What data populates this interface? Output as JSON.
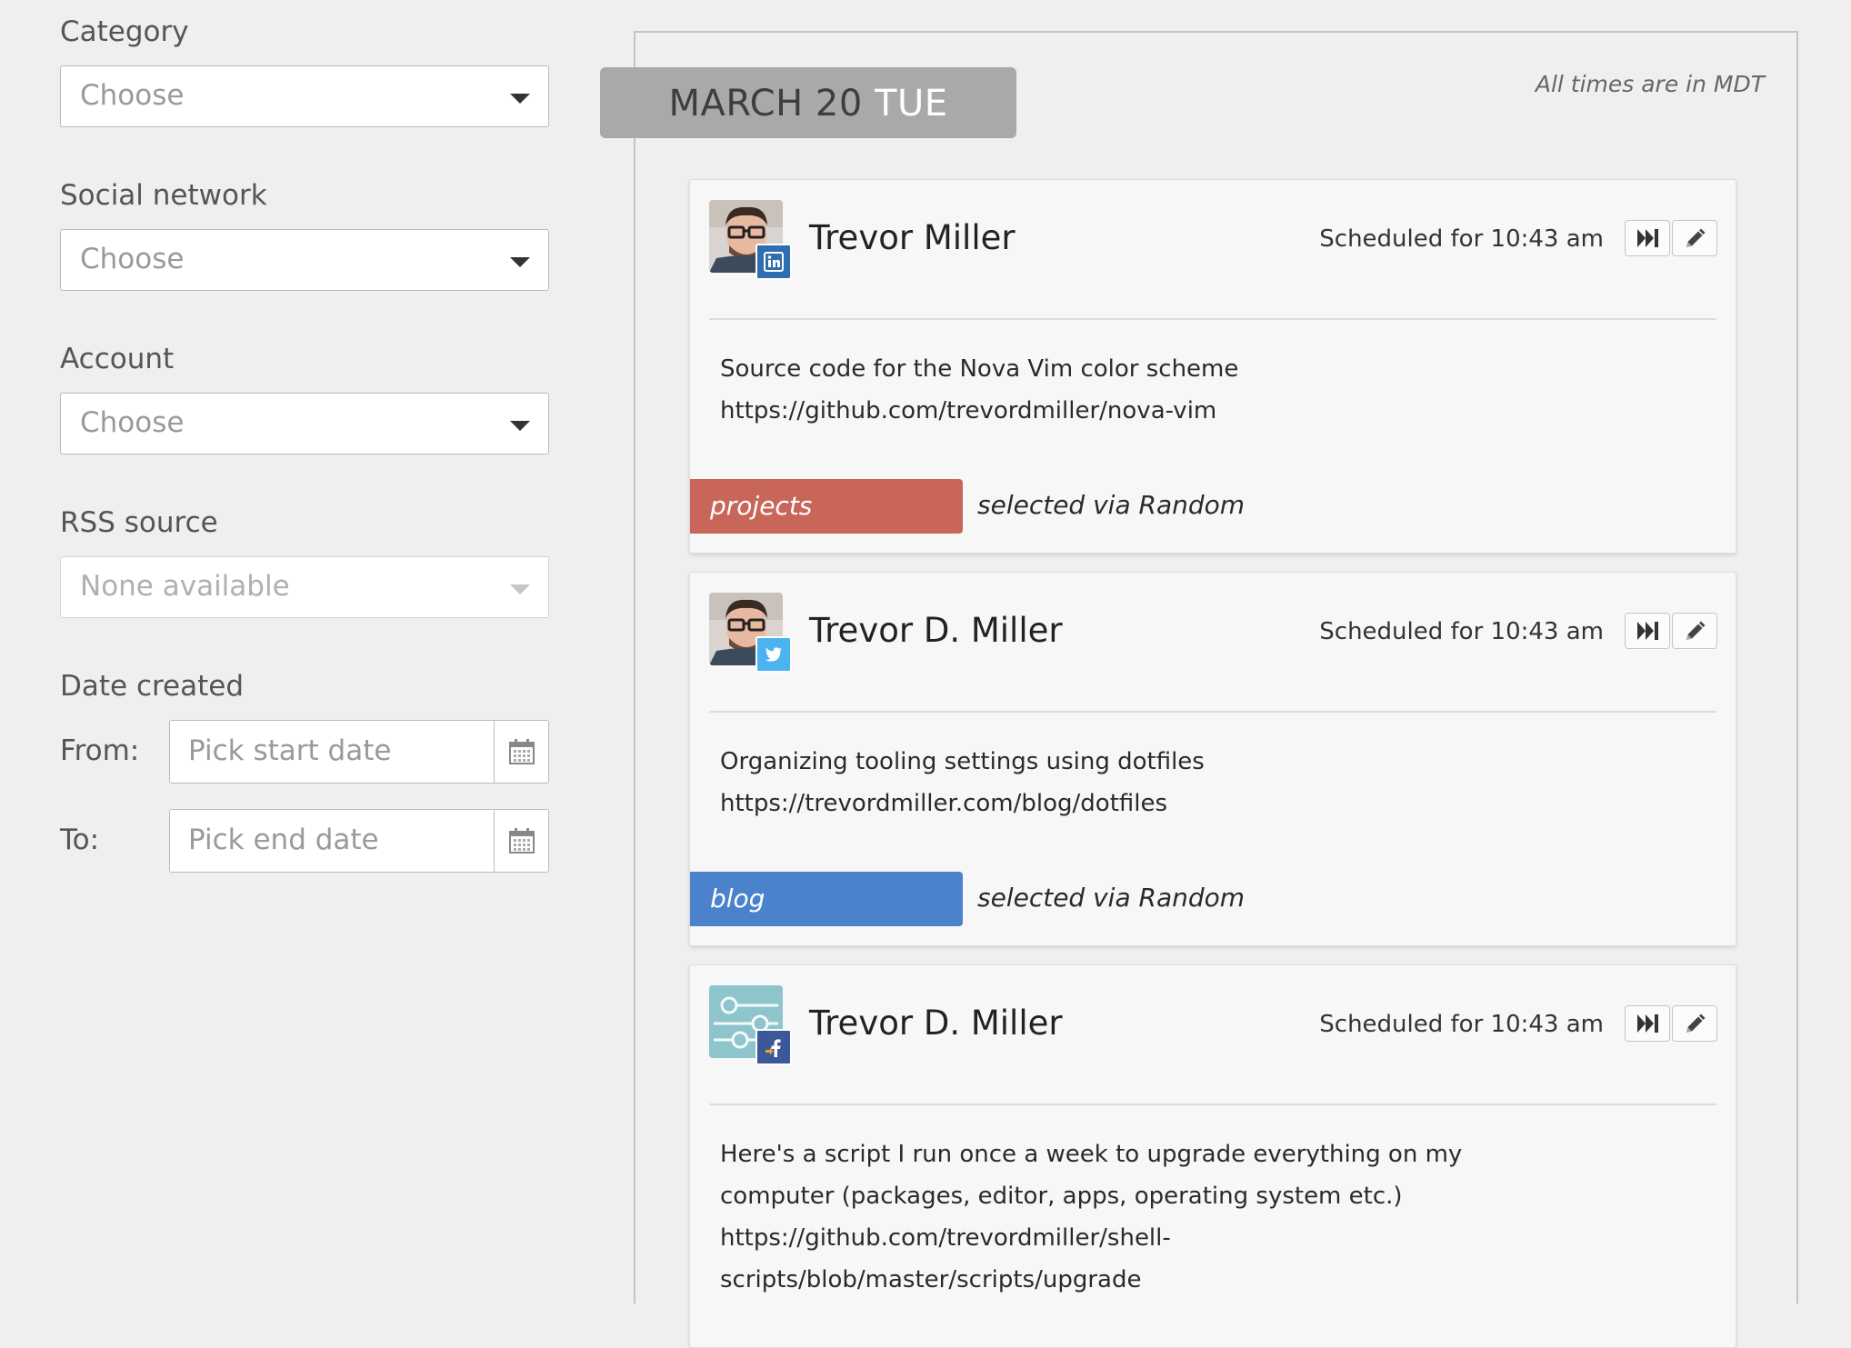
{
  "filters": {
    "category": {
      "label": "Category",
      "placeholder": "Choose"
    },
    "social_network": {
      "label": "Social network",
      "placeholder": "Choose"
    },
    "account": {
      "label": "Account",
      "placeholder": "Choose"
    },
    "rss_source": {
      "label": "RSS source",
      "placeholder": "None available"
    },
    "date_created": {
      "label": "Date created",
      "from_label": "From:",
      "from_placeholder": "Pick start date",
      "to_label": "To:",
      "to_placeholder": "Pick end date"
    }
  },
  "timeline": {
    "date_month_day": "MARCH 20",
    "date_weekday": "TUE",
    "timezone_note": "All times are in MDT",
    "posts": [
      {
        "author": "Trevor Miller",
        "network": "linkedin-icon",
        "scheduled": "Scheduled for 10:43 am",
        "lines": [
          "Source code for the Nova Vim color scheme",
          "https://github.com/trevordmiller/nova-vim"
        ],
        "tag": "projects",
        "tag_color": "#c9665a",
        "via": "selected via Random"
      },
      {
        "author": "Trevor D. Miller",
        "network": "twitter-icon",
        "scheduled": "Scheduled for 10:43 am",
        "lines": [
          "Organizing tooling settings using dotfiles",
          "https://trevordmiller.com/blog/dotfiles"
        ],
        "tag": "blog",
        "tag_color": "#4a82cc",
        "via": "selected via Random"
      },
      {
        "author": "Trevor D. Miller",
        "network": "facebook-icon",
        "scheduled": "Scheduled for 10:43 am",
        "lines": [
          "Here's a script I run once a week to upgrade everything on my",
          "computer (packages, editor, apps, operating system etc.)",
          "https://github.com/trevordmiller/shell-",
          "scripts/blob/master/scripts/upgrade"
        ]
      }
    ]
  },
  "colors": {
    "linkedin": "#2f6fb0",
    "twitter": "#4ab3f0",
    "facebook": "#3b5998",
    "badge_bg": "#a9a9a9"
  }
}
